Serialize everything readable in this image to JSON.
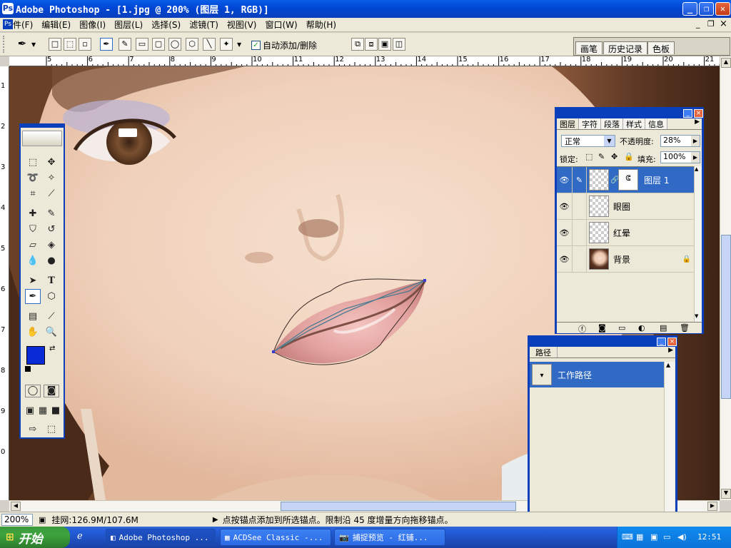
{
  "window": {
    "title": "Adobe Photoshop - [1.jpg @ 200% (图层 1, RGB)]",
    "app_icon": "photoshop-icon",
    "controls": [
      "_",
      "❐",
      "✕"
    ]
  },
  "menu": [
    "文件(F)",
    "编辑(E)",
    "图像(I)",
    "图层(L)",
    "选择(S)",
    "滤镜(T)",
    "视图(V)",
    "窗口(W)",
    "帮助(H)"
  ],
  "doc_controls": [
    "_",
    "❐",
    "×"
  ],
  "options": {
    "auto_add_delete_label": "自动添加/删除",
    "auto_add_delete_checked": true
  },
  "well_tabs": [
    "画笔",
    "历史记录",
    "色板"
  ],
  "ruler": {
    "top": [
      "5",
      "6",
      "7",
      "8",
      "9",
      "10",
      "11",
      "12",
      "13",
      "14",
      "15",
      "16",
      "17",
      "18",
      "19",
      "20",
      "21"
    ],
    "left": [
      "1",
      "2",
      "3",
      "4",
      "5",
      "6",
      "7",
      "8",
      "9",
      "0"
    ]
  },
  "tools": {
    "foreground_color": "#0a2bd6",
    "background_color": "#ffffff"
  },
  "layers_panel": {
    "tabs": [
      "图层",
      "字符",
      "段落",
      "样式",
      "信息"
    ],
    "blend_mode": "正常",
    "opacity_label": "不透明度:",
    "opacity": "28%",
    "lock_label": "锁定:",
    "fill_label": "填充:",
    "fill": "100%",
    "layers": [
      {
        "name": "图层 1",
        "selected": true,
        "has_mask": true
      },
      {
        "name": "眼圈",
        "selected": false
      },
      {
        "name": "红晕",
        "selected": false
      },
      {
        "name": "背景",
        "selected": false,
        "locked": true
      }
    ]
  },
  "paths_panel": {
    "tab": "路径",
    "paths": [
      {
        "name": "工作路径",
        "selected": true
      }
    ]
  },
  "status": {
    "zoom": "200%",
    "doc_info": "挂网:126.9M/107.6M",
    "hint": "点按锚点添加到所选锚点。限制沿 45 度增量方向拖移锚点。"
  },
  "taskbar": {
    "start": "开始",
    "tasks": [
      "Adobe Photoshop ...",
      "ACDSee Classic -...",
      "捕捉预览 - 红铺..."
    ],
    "clock": "12:51"
  }
}
